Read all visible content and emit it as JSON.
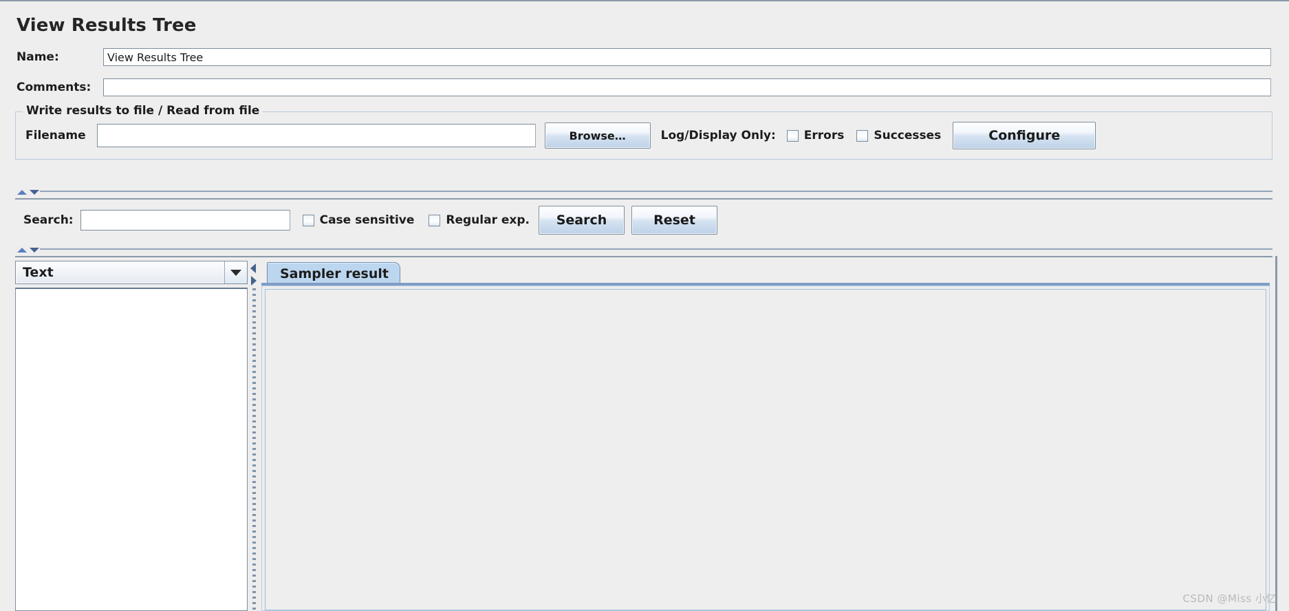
{
  "panel": {
    "title": "View Results Tree"
  },
  "form": {
    "name_label": "Name:",
    "name_value": "View Results Tree",
    "name_placeholder": "",
    "comments_label": "Comments:",
    "comments_value": "",
    "comments_placeholder": ""
  },
  "file_group": {
    "title": "Write results to file / Read from file",
    "filename_label": "Filename",
    "filename_value": "",
    "filename_placeholder": "",
    "browse_label": "Browse…",
    "log_display_label": "Log/Display Only:",
    "errors_label": "Errors",
    "errors_checked": false,
    "successes_label": "Successes",
    "successes_checked": false,
    "configure_label": "Configure"
  },
  "search": {
    "label": "Search:",
    "value": "",
    "placeholder": "",
    "case_sensitive_label": "Case sensitive",
    "case_sensitive_checked": false,
    "regex_label": "Regular exp.",
    "regex_checked": false,
    "search_button": "Search",
    "reset_button": "Reset"
  },
  "results": {
    "render_selected": "Text",
    "tabs": [
      {
        "label": "Sampler result",
        "selected": true
      }
    ],
    "tree_items": [],
    "result_content": ""
  },
  "watermark": "CSDN @Miss 小忆",
  "colors": {
    "window_bg": "#eeeeee",
    "field_bg": "#ffffff",
    "border": "#7d8c9b",
    "group_border": "#b9c9dc",
    "tab_selected_bg": "#bcd6ef",
    "splitter_arrow": "#5b7fbe",
    "text": "#1c1c1c"
  }
}
